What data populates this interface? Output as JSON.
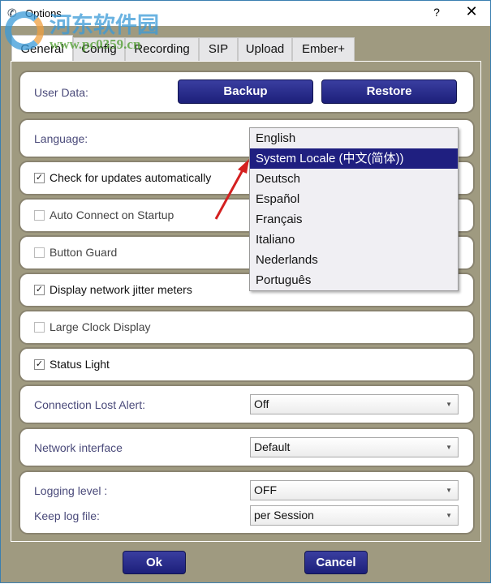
{
  "window": {
    "title": "Options",
    "help": "?",
    "close": "✕"
  },
  "watermark": {
    "line1": "河东软件园",
    "line2": "www.pc0359.cn"
  },
  "tabs": [
    {
      "label": "General",
      "active": true
    },
    {
      "label": "Config"
    },
    {
      "label": "Recording"
    },
    {
      "label": "SIP"
    },
    {
      "label": "Upload"
    },
    {
      "label": "Ember+"
    }
  ],
  "general": {
    "user_data_label": "User Data:",
    "backup": "Backup",
    "restore": "Restore",
    "language_label": "Language:",
    "language_options": [
      "English",
      "System Locale (中文(简体))",
      "Deutsch",
      "Español",
      "Français",
      "Italiano",
      "Nederlands",
      "Português"
    ],
    "language_highlighted": "System Locale (中文(简体))",
    "checkboxes": [
      {
        "label": "Check for updates automatically",
        "checked": true
      },
      {
        "label": "Auto Connect on Startup",
        "checked": false
      },
      {
        "label": "Button Guard",
        "checked": false
      },
      {
        "label": "Display network jitter meters",
        "checked": true
      },
      {
        "label": "Large Clock Display",
        "checked": false
      },
      {
        "label": "Status Light",
        "checked": true
      }
    ],
    "connection_lost_label": "Connection Lost Alert:",
    "connection_lost_value": "Off",
    "network_label": "Network interface",
    "network_value": "Default",
    "logging_label": "Logging level :",
    "logging_value": "OFF",
    "keeplog_label": "Keep log file:",
    "keeplog_value": "per Session"
  },
  "footer": {
    "ok": "Ok",
    "cancel": "Cancel"
  },
  "colors": {
    "button": "#1f2280",
    "highlight": "#1f1f80",
    "background": "#9f9a80",
    "annotation_arrow": "#d42020"
  }
}
